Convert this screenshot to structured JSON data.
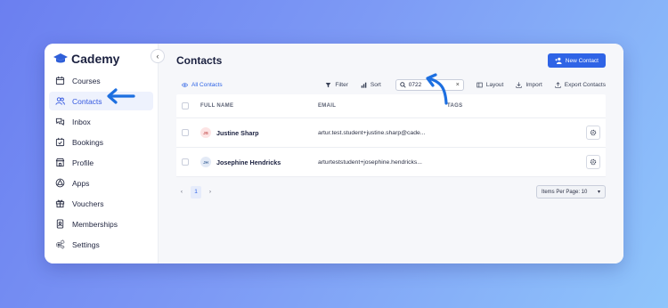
{
  "app": {
    "brand": "Cademy",
    "collapse_icon": "chevron-left-icon"
  },
  "sidebar": {
    "items": [
      {
        "label": "Courses",
        "icon": "calendar-icon",
        "active": false
      },
      {
        "label": "Contacts",
        "icon": "users-icon",
        "active": true
      },
      {
        "label": "Inbox",
        "icon": "chat-icon",
        "active": false
      },
      {
        "label": "Bookings",
        "icon": "calendar-check-icon",
        "active": false
      },
      {
        "label": "Profile",
        "icon": "storefront-icon",
        "active": false
      },
      {
        "label": "Apps",
        "icon": "apps-icon",
        "active": false
      },
      {
        "label": "Vouchers",
        "icon": "gift-icon",
        "active": false
      },
      {
        "label": "Memberships",
        "icon": "id-card-icon",
        "active": false
      },
      {
        "label": "Settings",
        "icon": "gears-icon",
        "active": false
      }
    ]
  },
  "main": {
    "title": "Contacts",
    "new_button": "New Contact",
    "toolbar": {
      "view_label": "All Contacts",
      "filter": "Filter",
      "sort": "Sort",
      "search_value": "0722",
      "clear": "×",
      "layout": "Layout",
      "import": "Import",
      "export": "Export Contacts"
    },
    "table": {
      "headers": {
        "name": "FULL NAME",
        "email": "EMAIL",
        "tags": "TAGS"
      },
      "rows": [
        {
          "initials": "JS",
          "name": "Justine Sharp",
          "email": "artur.test.student+justine.sharp@cade..."
        },
        {
          "initials": "JH",
          "name": "Josephine Hendricks",
          "email": "arturteststudent+josephine.hendricks..."
        }
      ]
    },
    "pagination": {
      "prev": "‹",
      "current": "1",
      "next": "›",
      "per_page": "Items Per Page: 10",
      "caret": "▾"
    }
  },
  "colors": {
    "accent": "#2f64e6",
    "annotation_arrow": "#1d6fe0"
  }
}
